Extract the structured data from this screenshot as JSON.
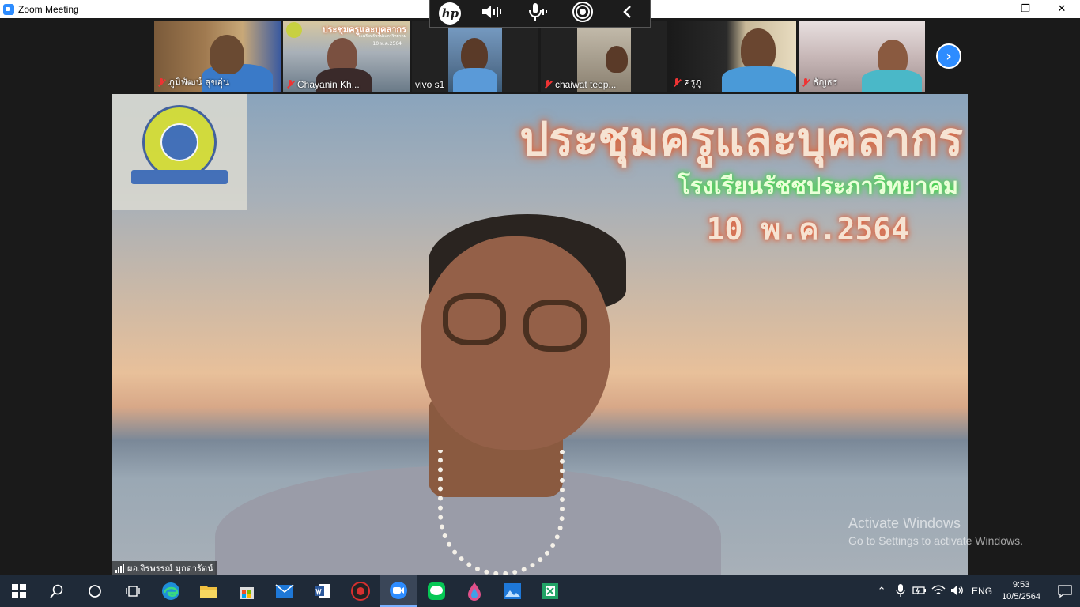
{
  "window": {
    "title": "Zoom Meeting",
    "controls": {
      "minimize": "—",
      "maximize": "❐",
      "close": "✕"
    }
  },
  "hp_toolbar": {
    "logo": "hp",
    "icons": [
      "speaker-icon",
      "microphone-icon",
      "broadcast-icon",
      "chevron-left-icon"
    ]
  },
  "participants": [
    {
      "name": "ภูมิพัฒน์ สุขอุ่น",
      "muted": true
    },
    {
      "name": "Chayanin Kh...",
      "muted": true
    },
    {
      "name": "vivo s1",
      "muted": false
    },
    {
      "name": "chaiwat teep...",
      "muted": true
    },
    {
      "name": "ครูภู",
      "muted": true
    },
    {
      "name": "ธัญธร",
      "muted": true
    }
  ],
  "thumbnail_slide": {
    "title": "ประชุมครูและบุคลากร",
    "school": "โรงเรียนรัชชประภาวิทยาคม",
    "date": "10 พ.ค.2564"
  },
  "main_video": {
    "title": "ประชุมครูและบุคลากร",
    "school": "โรงเรียนรัชชประภาวิทยาคม",
    "date": "10 พ.ค.2564",
    "presenter_name": "ผอ.จิรพรรณ์ มุกดารัตน์"
  },
  "watermark": {
    "line1": "Activate Windows",
    "line2": "Go to Settings to activate Windows."
  },
  "taskbar": {
    "apps": [
      "windows-start-icon",
      "search-icon",
      "cortana-icon",
      "task-view-icon",
      "edge-icon",
      "file-explorer-icon",
      "store-icon",
      "mail-icon",
      "word-icon",
      "app-red-icon",
      "zoom-icon",
      "line-icon",
      "paint-icon",
      "photos-icon",
      "excel-icon"
    ],
    "active_app": "zoom-icon",
    "language": "ENG",
    "time": "9:53",
    "date": "10/5/2564"
  },
  "colors": {
    "zoom_blue": "#2d8cff",
    "taskbar": "#1f2a38",
    "mute_red": "#e33333"
  }
}
